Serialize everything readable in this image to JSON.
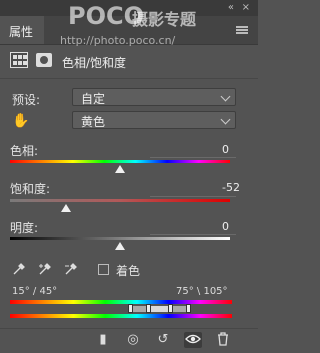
{
  "top_strip": {
    "collapse_label": "«",
    "close_label": "×"
  },
  "watermark": {
    "logo": "POCO",
    "name": "摄影专题",
    "url": "http://photo.poco.cn/"
  },
  "panel": {
    "tab_label": "属性"
  },
  "adjustment": {
    "title": "色相/饱和度"
  },
  "preset": {
    "label": "预设:",
    "value": "自定"
  },
  "channel": {
    "value": "黄色"
  },
  "hue": {
    "label": "色相:",
    "value": "0"
  },
  "saturation": {
    "label": "饱和度:",
    "value": "-52"
  },
  "lightness": {
    "label": "明度:",
    "value": "0"
  },
  "colorize": {
    "label": "着色",
    "checked": false
  },
  "range": {
    "left": "15° / 45°",
    "right": "75° \\ 105°"
  },
  "icons": {
    "hand": "✋",
    "eyedropper": "𝒊",
    "clip": "▮",
    "view_prev": "◎",
    "reset": "↺",
    "visibility": "👁",
    "delete": "🗑"
  }
}
